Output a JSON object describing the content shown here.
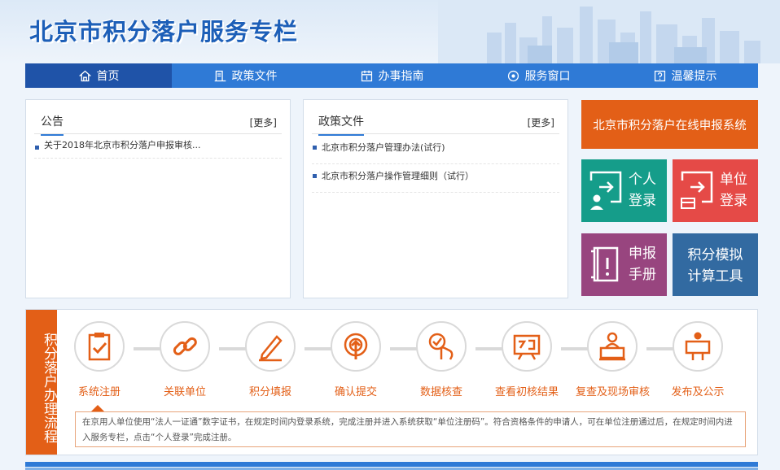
{
  "site_title": "北京市积分落户服务专栏",
  "nav": [
    {
      "label": "首页",
      "icon": "home-icon"
    },
    {
      "label": "政策文件",
      "icon": "policy-icon"
    },
    {
      "label": "办事指南",
      "icon": "calendar-icon"
    },
    {
      "label": "服务窗口",
      "icon": "location-icon"
    },
    {
      "label": "温馨提示",
      "icon": "question-icon"
    }
  ],
  "notice": {
    "title": "公告",
    "more": "[更多]",
    "items": [
      "关于2018年北京市积分落户申报审核..."
    ]
  },
  "policy": {
    "title": "政策文件",
    "more": "[更多]",
    "items": [
      "北京市积分落户管理办法(试行)",
      "北京市积分落户操作管理细则（试行）"
    ]
  },
  "tiles": {
    "online_system": "北京市积分落户在线申报系统",
    "personal_login_1": "个人",
    "personal_login_2": "登录",
    "unit_login_1": "单位",
    "unit_login_2": "登录",
    "manual_1": "申报",
    "manual_2": "手册",
    "calc_1": "积分模拟",
    "calc_2": "计算工具"
  },
  "colors": {
    "nav_blue": "#2f7ad6",
    "orange": "#e35f17",
    "teal": "#159d8a",
    "red": "#e54a47",
    "purple": "#98457f",
    "steel_blue": "#326aa1"
  },
  "process": {
    "label": "积分落户办理流程",
    "steps": [
      {
        "label": "系统注册",
        "icon": "register-icon"
      },
      {
        "label": "关联单位",
        "icon": "link-icon"
      },
      {
        "label": "积分填报",
        "icon": "pen-icon"
      },
      {
        "label": "确认提交",
        "icon": "submit-icon"
      },
      {
        "label": "数据核查",
        "icon": "check-icon"
      },
      {
        "label": "查看初核结果",
        "icon": "result-icon"
      },
      {
        "label": "复查及现场审核",
        "icon": "onsite-icon"
      },
      {
        "label": "发布及公示",
        "icon": "publish-icon"
      }
    ],
    "description": "在京用人单位使用“法人一证通”数字证书，在规定时间内登录系统，完成注册并进入系统获取“单位注册码”。符合资格条件的申请人，可在单位注册通过后，在规定时间内进入服务专栏，点击“个人登录”完成注册。"
  }
}
